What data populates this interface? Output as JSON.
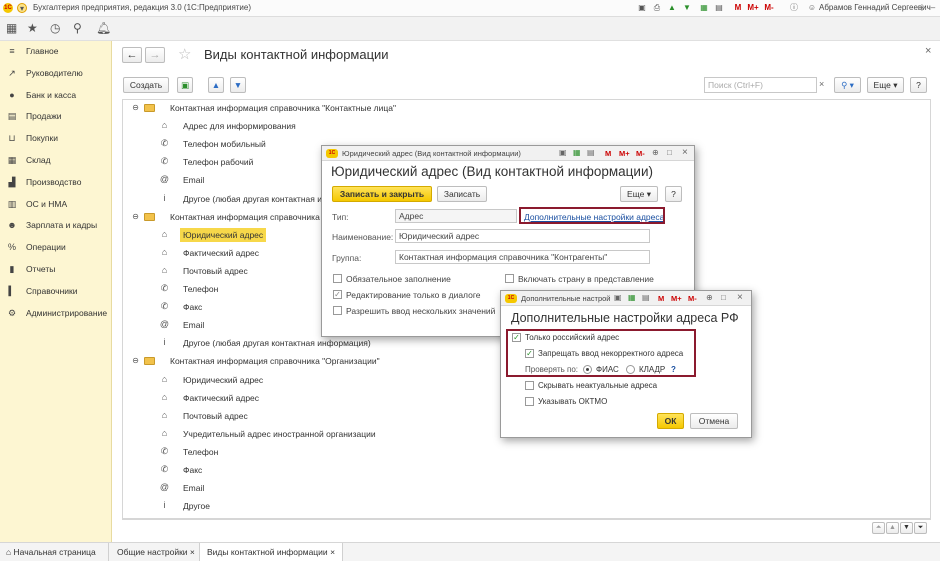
{
  "app": {
    "title": "Бухгалтерия предприятия, редакция 3.0  (1С:Предприятие)",
    "user": "Абрамов Геннадий Сергеевич",
    "title_icons": [
      "M",
      "M+",
      "M-"
    ]
  },
  "sidebar": {
    "items": [
      {
        "label": "Главное",
        "icon": "≡"
      },
      {
        "label": "Руководителю",
        "icon": "↗"
      },
      {
        "label": "Банк и касса",
        "icon": "●"
      },
      {
        "label": "Продажи",
        "icon": "▤"
      },
      {
        "label": "Покупки",
        "icon": "⊔"
      },
      {
        "label": "Склад",
        "icon": "▦"
      },
      {
        "label": "Производство",
        "icon": "▟"
      },
      {
        "label": "ОС и НМА",
        "icon": "▥"
      },
      {
        "label": "Зарплата и кадры",
        "icon": "☻"
      },
      {
        "label": "Операции",
        "icon": "%"
      },
      {
        "label": "Отчеты",
        "icon": "▮"
      },
      {
        "label": "Справочники",
        "icon": "▍"
      },
      {
        "label": "Администрирование",
        "icon": "⚙"
      }
    ]
  },
  "main": {
    "title": "Виды контактной информации",
    "create_label": "Создать",
    "search_placeholder": "Поиск (Ctrl+F)",
    "more_label": "Еще",
    "help_label": "?"
  },
  "tree": {
    "groups": [
      {
        "label": "Контактная информация справочника \"Контактные лица\"",
        "items": [
          {
            "label": "Адрес для информирования",
            "icon": "⌂"
          },
          {
            "label": "Телефон мобильный",
            "icon": "✆"
          },
          {
            "label": "Телефон рабочий",
            "icon": "✆"
          },
          {
            "label": "Email",
            "icon": "@"
          },
          {
            "label": "Другое (любая другая контактная информация)",
            "icon": "i"
          }
        ]
      },
      {
        "label": "Контактная информация справочника \"Контрагенты\"",
        "items": [
          {
            "label": "Юридический адрес",
            "icon": "⌂"
          },
          {
            "label": "Фактический адрес",
            "icon": "⌂"
          },
          {
            "label": "Почтовый адрес",
            "icon": "⌂"
          },
          {
            "label": "Телефон",
            "icon": "✆"
          },
          {
            "label": "Факс",
            "icon": "✆"
          },
          {
            "label": "Email",
            "icon": "@"
          },
          {
            "label": "Другое (любая другая контактная информация)",
            "icon": "i"
          }
        ]
      },
      {
        "label": "Контактная информация справочника \"Организации\"",
        "items": [
          {
            "label": "Юридический адрес",
            "icon": "⌂"
          },
          {
            "label": "Фактический адрес",
            "icon": "⌂"
          },
          {
            "label": "Почтовый адрес",
            "icon": "⌂"
          },
          {
            "label": "Учредительный адрес иностранной организации",
            "icon": "⌂"
          },
          {
            "label": "Телефон",
            "icon": "✆"
          },
          {
            "label": "Факс",
            "icon": "✆"
          },
          {
            "label": "Email",
            "icon": "@"
          },
          {
            "label": "Другое",
            "icon": "i"
          }
        ]
      }
    ]
  },
  "dialog1": {
    "window_title": "Юридический адрес (Вид контактной информации)",
    "heading": "Юридический адрес (Вид контактной информации)",
    "save_close": "Записать и закрыть",
    "save": "Записать",
    "more": "Еще",
    "help": "?",
    "type_label": "Тип:",
    "type_value": "Адрес",
    "extra_link": "Дополнительные настройки адреса",
    "name_label": "Наименование:",
    "name_value": "Юридический адрес",
    "group_label": "Группа:",
    "group_value": "Контактная информация справочника \"Контрагенты\"",
    "cb_required": "Обязательное заполнение",
    "cb_country": "Включать страну в представление",
    "cb_dialog_only": "Редактирование только в диалоге",
    "cb_multiple": "Разрешить ввод нескольких значений"
  },
  "dialog2": {
    "window_title": "Дополнительные настрой",
    "heading": "Дополнительные настройки адреса РФ",
    "cb_russian_only": "Только российский адрес",
    "cb_forbid_incorrect": "Запрещать ввод некорректного адреса",
    "check_by_label": "Проверять по:",
    "radio_fias": "ФИАС",
    "radio_kladr": "КЛАДР",
    "radio_help": "?",
    "cb_hide_obsolete": "Скрывать неактуальные адреса",
    "cb_oktmo": "Указывать ОКТМО",
    "ok": "ОК",
    "cancel": "Отмена",
    "toolbar_text": [
      "M",
      "M+",
      "M-"
    ]
  },
  "tabs": {
    "home": "Начальная страница",
    "t1": "Общие настройки",
    "t2": "Виды контактной информации"
  },
  "colors": {
    "accent_yellow": "#f5c800",
    "highlight_frame": "#8b1a2e",
    "sidebar_bg": "#fdf6d2",
    "link": "#1a4fa0",
    "selected_row": "#f7d84a"
  }
}
